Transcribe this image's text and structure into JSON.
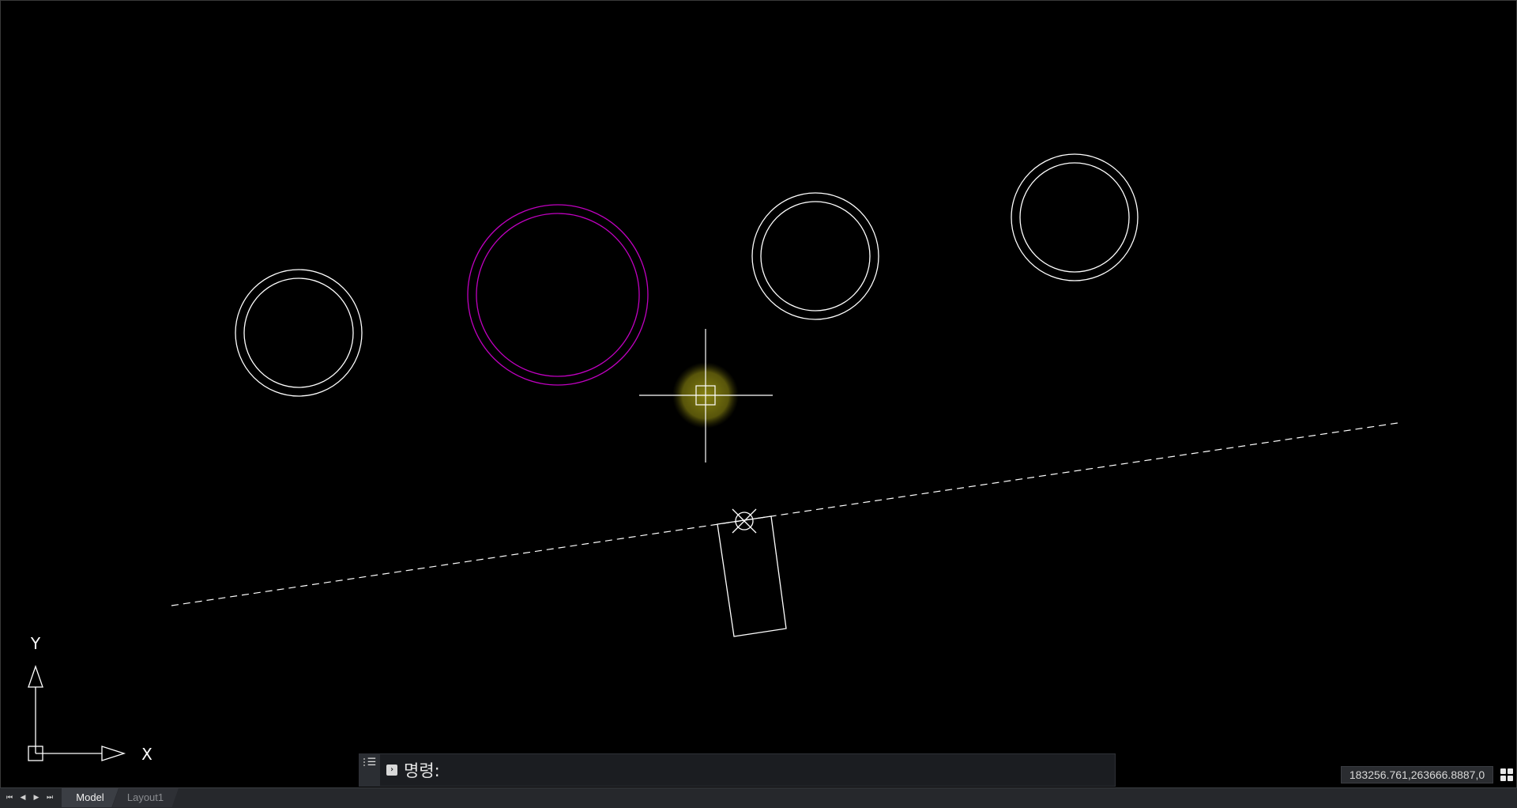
{
  "ucs": {
    "x_label": "X",
    "y_label": "Y"
  },
  "colors": {
    "background": "#000000",
    "entity": "#ffffff",
    "selected_circle": "#c000c0",
    "cursor_highlight": "#a09a10"
  },
  "command": {
    "label": "명령:",
    "value": "",
    "placeholder": "",
    "grip_icon": "grip-icon",
    "menu_icon": "menu-icon",
    "prompt_icon": "command-prompt-icon"
  },
  "status": {
    "coordinates": "183256.761,263666.8887,0",
    "grid_icon": "grid-icon"
  },
  "tabs": [
    {
      "label": "Model",
      "active": true
    },
    {
      "label": "Layout1",
      "active": false
    }
  ],
  "tab_nav": {
    "first": "⏮",
    "prev": "◀",
    "next": "▶",
    "last": "⏭"
  }
}
